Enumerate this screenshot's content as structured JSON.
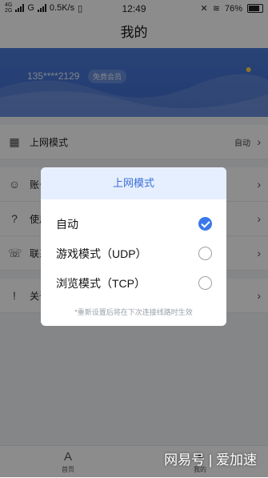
{
  "status_bar": {
    "sim1": "4G",
    "sim2": "2G",
    "carrier": "G",
    "speed": "0.5K/s",
    "time": "12:49",
    "battery": "76%"
  },
  "header": {
    "title": "我的"
  },
  "profile": {
    "phone": "135****2129",
    "badge": "免费会员"
  },
  "menu": [
    {
      "label": "上网模式",
      "value": "自动"
    },
    {
      "label": "账号信息",
      "value": ""
    },
    {
      "label": "使用帮助",
      "value": ""
    },
    {
      "label": "联系客服",
      "value": ""
    },
    {
      "label": "关于我们",
      "value": ""
    }
  ],
  "dialog": {
    "title": "上网模式",
    "options": [
      {
        "label": "自动",
        "selected": true
      },
      {
        "label": "游戏模式（UDP）",
        "selected": false
      },
      {
        "label": "浏览模式（TCP）",
        "selected": false
      }
    ],
    "note": "*重新设置后将在下次连接线路时生效"
  },
  "tabbar": {
    "home": "首页",
    "mine": "我的"
  },
  "watermark": "网易号 | 爱加速"
}
